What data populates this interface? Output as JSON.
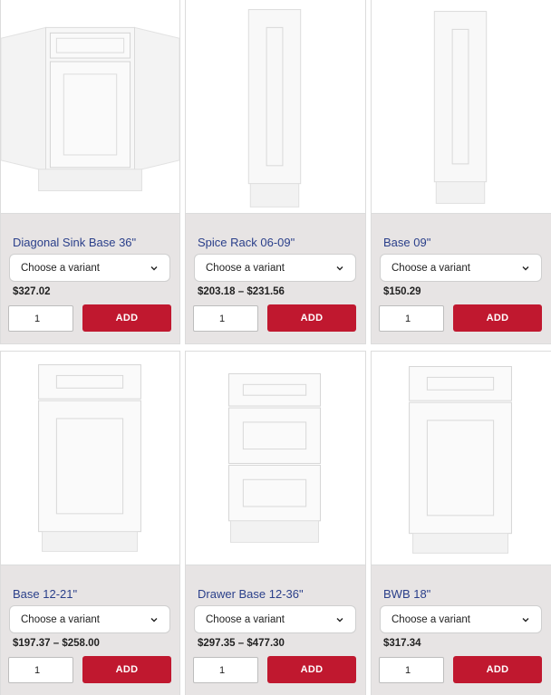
{
  "products": [
    {
      "title": "Diagonal Sink Base 36\"",
      "variant_placeholder": "Choose a variant",
      "price": "$327.02",
      "qty": "1",
      "add_label": "ADD",
      "image": "diagonal-sink-base-image"
    },
    {
      "title": "Spice Rack 06-09\"",
      "variant_placeholder": "Choose a variant",
      "price": "$203.18 – $231.56",
      "qty": "1",
      "add_label": "ADD",
      "image": "spice-rack-image"
    },
    {
      "title": "Base 09\"",
      "variant_placeholder": "Choose a variant",
      "price": "$150.29",
      "qty": "1",
      "add_label": "ADD",
      "image": "base-09-image"
    },
    {
      "title": "Base 12-21\"",
      "variant_placeholder": "Choose a variant",
      "price": "$197.37 – $258.00",
      "qty": "1",
      "add_label": "ADD",
      "image": "base-12-21-image"
    },
    {
      "title": "Drawer Base 12-36\"",
      "variant_placeholder": "Choose a variant",
      "price": "$297.35 – $477.30",
      "qty": "1",
      "add_label": "ADD",
      "image": "drawer-base-image"
    },
    {
      "title": "BWB 18\"",
      "variant_placeholder": "Choose a variant",
      "price": "$317.34",
      "qty": "1",
      "add_label": "ADD",
      "image": "bwb-18-image"
    }
  ],
  "colors": {
    "accent": "#c0182f",
    "title": "#2a3f8a",
    "card_bg": "#e7e4e4"
  }
}
